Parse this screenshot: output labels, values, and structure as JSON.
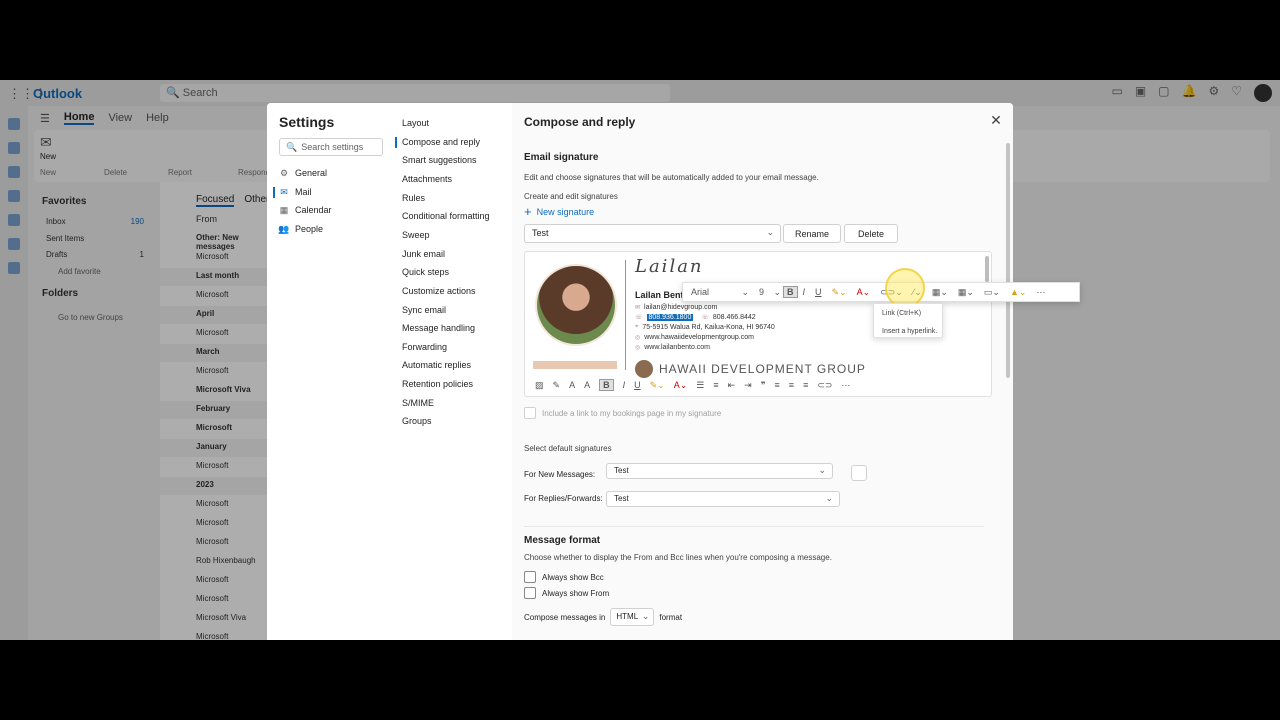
{
  "app": {
    "name": "Outlook",
    "search_placeholder": "Search",
    "ribbon_tabs": [
      "Home",
      "View",
      "Help"
    ],
    "ribbon_groups": [
      "New",
      "Delete",
      "Report",
      "Respond"
    ],
    "ribbon_new_label": "New"
  },
  "nav": {
    "favorites": "Favorites",
    "inbox": "Inbox",
    "inbox_count": "190",
    "sent": "Sent Items",
    "drafts": "Drafts",
    "drafts_count": "1",
    "add_favorite": "Add favorite",
    "folders": "Folders",
    "groups": "Go to new Groups"
  },
  "maillist": {
    "tab_focused": "Focused",
    "tab_other": "Other",
    "from_header": "From",
    "items": [
      "Other: New messages",
      "Microsoft",
      "Last month",
      "Microsoft",
      "April",
      "Microsoft",
      "March",
      "Microsoft",
      "Microsoft Viva",
      "February",
      "Microsoft",
      "January",
      "Microsoft",
      "2023",
      "Microsoft",
      "Microsoft",
      "Microsoft",
      "Rob Hixenbaugh",
      "Microsoft",
      "Microsoft",
      "Microsoft Viva",
      "Microsoft"
    ]
  },
  "settings": {
    "title": "Settings",
    "search_placeholder": "Search settings",
    "categories": [
      "General",
      "Mail",
      "Calendar",
      "People"
    ],
    "subcategories": [
      "Layout",
      "Compose and reply",
      "Smart suggestions",
      "Attachments",
      "Rules",
      "Conditional formatting",
      "Sweep",
      "Junk email",
      "Quick steps",
      "Customize actions",
      "Sync email",
      "Message handling",
      "Forwarding",
      "Automatic replies",
      "Retention policies",
      "S/MIME",
      "Groups"
    ]
  },
  "pane": {
    "title": "Compose and reply",
    "email_signature": "Email signature",
    "signature_desc": "Edit and choose signatures that will be automatically added to your email message.",
    "create_edit": "Create and edit signatures",
    "new_signature": "New signature",
    "signature_selected": "Test",
    "rename": "Rename",
    "delete": "Delete",
    "bookings_link": "Include a link to my bookings page in my signature",
    "select_defaults": "Select default signatures",
    "for_new_label": "For New Messages:",
    "for_new_value": "Test",
    "for_replies_label": "For Replies/Forwards:",
    "for_replies_value": "Test",
    "message_format": "Message format",
    "format_desc": "Choose whether to display the From and Bcc lines when you're composing a message.",
    "always_bcc": "Always show Bcc",
    "always_from": "Always show From",
    "compose_in": "Compose messages in",
    "compose_format": "HTML",
    "format_word": "format"
  },
  "signature": {
    "script": "Lailan",
    "name": "Lailan Bento",
    "email": "lailan@hidevgroup.com",
    "phone1": "808.936.1800",
    "phone2": "808.466.8442",
    "address": "75-5915 Walua Rd, Kailua-Kona, HI 96740",
    "site1": "www.hawaiidevelopmentgroup.com",
    "site2": "www.lailanbento.com",
    "company": "HAWAII DEVELOPMENT GROUP"
  },
  "float_toolbar": {
    "font": "Arial",
    "size": "9"
  },
  "tooltip": {
    "title": "Link (Ctrl+K)",
    "desc": "Insert a hyperlink."
  }
}
